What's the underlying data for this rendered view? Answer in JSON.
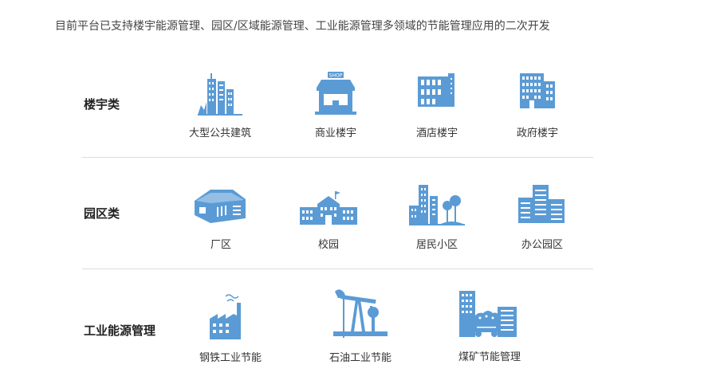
{
  "intro": "目前平台已支持楼宇能源管理、园区/区域能源管理、工业能源管理多领域的节能管理应用的二次开发",
  "icon_color": "#5b9bd5",
  "categories": [
    {
      "label": "楼宇类",
      "items": [
        {
          "label": "大型公共建筑",
          "icon": "public-building-icon"
        },
        {
          "label": "商业楼宇",
          "icon": "shop-icon"
        },
        {
          "label": "酒店楼宇",
          "icon": "hotel-icon"
        },
        {
          "label": "政府楼宇",
          "icon": "government-building-icon"
        }
      ]
    },
    {
      "label": "园区类",
      "items": [
        {
          "label": "厂区",
          "icon": "factory-hall-icon"
        },
        {
          "label": "校园",
          "icon": "campus-icon"
        },
        {
          "label": "居民小区",
          "icon": "residential-icon"
        },
        {
          "label": "办公园区",
          "icon": "office-park-icon"
        }
      ]
    },
    {
      "label": "工业能源管理",
      "items": [
        {
          "label": "钢铁工业节能",
          "icon": "steel-factory-icon"
        },
        {
          "label": "石油工业节能",
          "icon": "oil-pump-icon"
        },
        {
          "label": "煤矿节能管理",
          "icon": "coal-mine-icon"
        }
      ]
    }
  ]
}
